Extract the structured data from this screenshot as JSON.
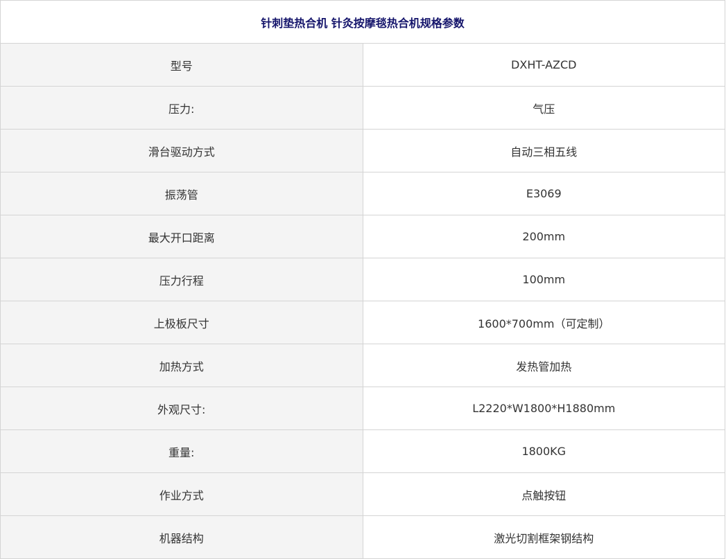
{
  "title": "针刺垫热合机 针灸按摩毯热合机规格参数",
  "specs": [
    {
      "label": "型号",
      "value": "DXHT-AZCD"
    },
    {
      "label": "压力:",
      "value": "气压"
    },
    {
      "label": "滑台驱动方式",
      "value": "自动三相五线"
    },
    {
      "label": "振荡管",
      "value": "E3069"
    },
    {
      "label": "最大开口距离",
      "value": "200mm"
    },
    {
      "label": "压力行程",
      "value": "100mm"
    },
    {
      "label": "上极板尺寸",
      "value": "1600*700mm（可定制）"
    },
    {
      "label": "加热方式",
      "value": "发热管加热"
    },
    {
      "label": "外观尺寸:",
      "value": "L2220*W1800*H1880mm"
    },
    {
      "label": "重量:",
      "value": "1800KG"
    },
    {
      "label": "作业方式",
      "value": "点触按钮"
    },
    {
      "label": "机器结构",
      "value": "激光切割框架钢结构"
    }
  ]
}
